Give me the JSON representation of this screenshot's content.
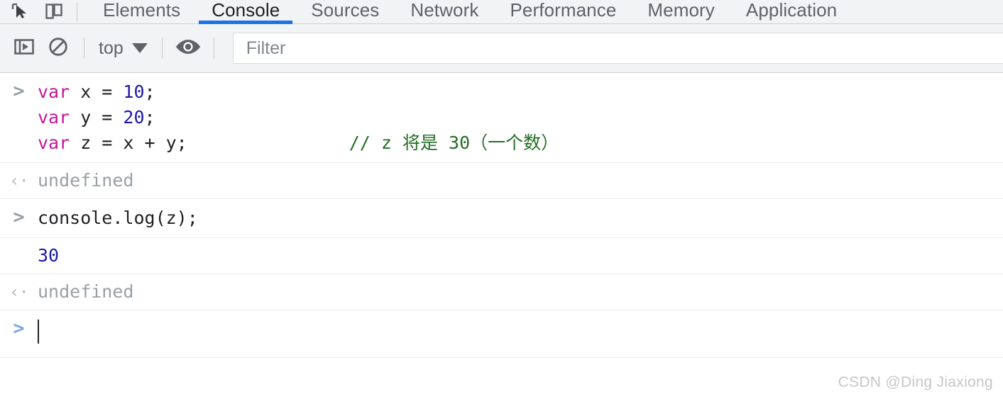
{
  "window": {
    "title": "Chrome DevTools — Console"
  },
  "toolbar_icons": {
    "inspect": "inspect-element-icon",
    "device": "device-toolbar-icon"
  },
  "tabs": [
    {
      "label": "Elements",
      "active": false
    },
    {
      "label": "Console",
      "active": true
    },
    {
      "label": "Sources",
      "active": false
    },
    {
      "label": "Network",
      "active": false
    },
    {
      "label": "Performance",
      "active": false
    },
    {
      "label": "Memory",
      "active": false
    },
    {
      "label": "Application",
      "active": false
    }
  ],
  "console_toolbar": {
    "sidebar_toggle": "show-console-sidebar-icon",
    "clear_console": "clear-console-icon",
    "context_label": "top",
    "live_expression": "eye-icon",
    "filter_placeholder": "Filter",
    "filter_value": ""
  },
  "console_messages": [
    {
      "kind": "input",
      "prompt": ">",
      "lines": [
        {
          "tokens": [
            {
              "text": "var",
              "type": "keyword"
            },
            {
              "text": " x = ",
              "type": "plain"
            },
            {
              "text": "10",
              "type": "number"
            },
            {
              "text": ";",
              "type": "plain"
            }
          ]
        },
        {
          "tokens": [
            {
              "text": "var",
              "type": "keyword"
            },
            {
              "text": " y = ",
              "type": "plain"
            },
            {
              "text": "20",
              "type": "number"
            },
            {
              "text": ";",
              "type": "plain"
            }
          ]
        },
        {
          "tokens": [
            {
              "text": "var",
              "type": "keyword"
            },
            {
              "text": " z = x + y;",
              "type": "plain"
            },
            {
              "text": "// z 将是 30（一个数）",
              "type": "comment"
            }
          ]
        }
      ]
    },
    {
      "kind": "result",
      "arrow": "‹·",
      "text": "undefined"
    },
    {
      "kind": "input",
      "prompt": ">",
      "lines": [
        {
          "tokens": [
            {
              "text": "console.log(z);",
              "type": "plain"
            }
          ]
        }
      ]
    },
    {
      "kind": "output",
      "text": "30"
    },
    {
      "kind": "result",
      "arrow": "‹·",
      "text": "undefined"
    }
  ],
  "active_prompt": {
    "prompt": ">",
    "value": ""
  },
  "watermark": "CSDN @Ding Jiaxiong",
  "colors": {
    "accent": "#1a73e8",
    "toolbar_bg": "#f1f3f4",
    "keyword": "#c5169c",
    "number": "#1a1aa6",
    "comment": "#236e25",
    "muted": "#9aa0a6"
  }
}
